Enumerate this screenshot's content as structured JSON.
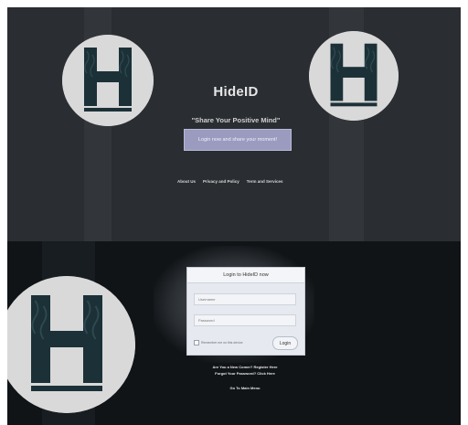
{
  "landing": {
    "brand": "HideID",
    "tagline": "\"Share Your Positive Mind\"",
    "cta_label": "Login now and share your moment!",
    "footer_links": [
      "About Us",
      "Privacy and Policy",
      "Term and Services"
    ]
  },
  "login": {
    "header": "Login to HideID now",
    "username_placeholder": "Username",
    "password_placeholder": "Password",
    "remember_label": "Remember me on this device",
    "login_label": "Login",
    "register_link": "Are You a New Comer? Register Here",
    "forgot_link": "Forgot Your Password? Click Here",
    "more_link": "Go To Main Menu"
  },
  "colors": {
    "top_bg": "#2a2d31",
    "bottom_bg": "#101417",
    "accent": "#9b9bc0",
    "logo_bg": "#d9d9d9"
  }
}
